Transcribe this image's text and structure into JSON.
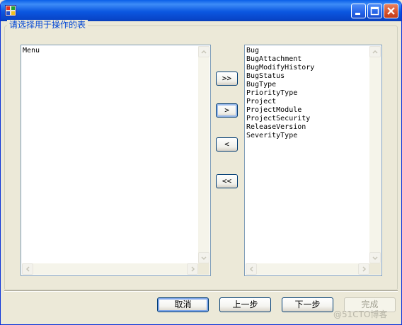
{
  "window": {
    "icon": "app-window-icon",
    "controls": [
      "minimize-icon",
      "maximize-icon",
      "close-icon"
    ]
  },
  "group": {
    "label": "请选择用于操作的表"
  },
  "left_list": {
    "items": [
      "Menu"
    ]
  },
  "right_list": {
    "items": [
      "Bug",
      "BugAttachment",
      "BugModifyHistory",
      "BugStatus",
      "BugType",
      "PriorityType",
      "Project",
      "ProjectModule",
      "ProjectSecurity",
      "ReleaseVersion",
      "SeverityType"
    ]
  },
  "move_buttons": {
    "move_all_right": ">>",
    "move_right": ">",
    "move_left": "<",
    "move_all_left": "<<"
  },
  "footer": {
    "cancel": "取消",
    "previous": "上一步",
    "next": "下一步",
    "finish": "完成"
  },
  "watermark": "@51CTO博客",
  "colors": {
    "titlebar": "#0a5fe8",
    "window_face": "#ece9d8",
    "group_label": "#0046d5",
    "list_border": "#7f9db9",
    "close_button": "#d5512b"
  }
}
